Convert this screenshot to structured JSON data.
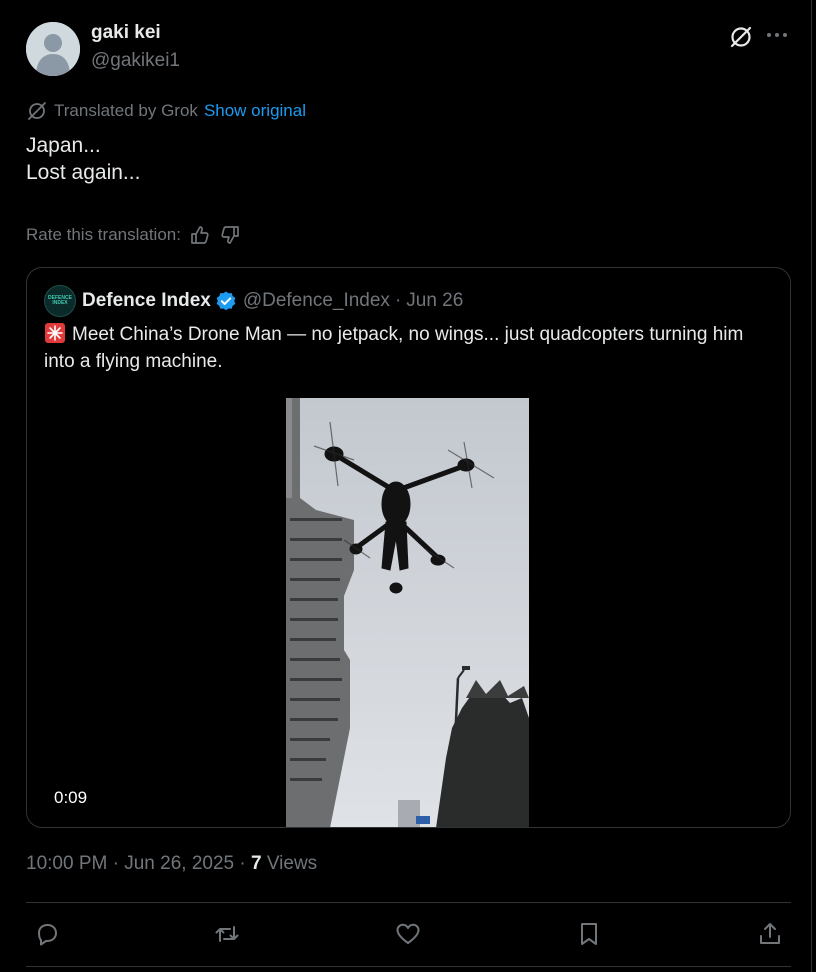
{
  "author": {
    "name": "gaki kei",
    "handle": "@gakikei1",
    "avatar": "default-avatar"
  },
  "translation": {
    "note": "Translated by Grok",
    "show_original": "Show original",
    "rate_label": "Rate this translation:"
  },
  "tweet": {
    "lines": [
      "Japan...",
      "Lost again..."
    ]
  },
  "quote": {
    "avatar_text": "DEFENCE INDEX",
    "name": "Defence Index",
    "handle": "@Defence_Index",
    "separator": "·",
    "date": "Jun 26",
    "emoji": "siren-icon",
    "text": "Meet China’s Drone Man — no jetpack, no wings... just quadcopters turning him into a flying machine.",
    "video_duration": "0:09"
  },
  "meta": {
    "time": "10:00 PM",
    "dot": "·",
    "date": "Jun 26, 2025",
    "views_count": "7",
    "views_label": "Views"
  },
  "actions": [
    "reply-icon",
    "repost-icon",
    "like-icon",
    "bookmark-icon",
    "share-icon"
  ],
  "colors": {
    "background": "#000000",
    "text": "#e7e9ea",
    "secondary": "#71767b",
    "link": "#1d9bf0",
    "border": "#2f3336"
  }
}
